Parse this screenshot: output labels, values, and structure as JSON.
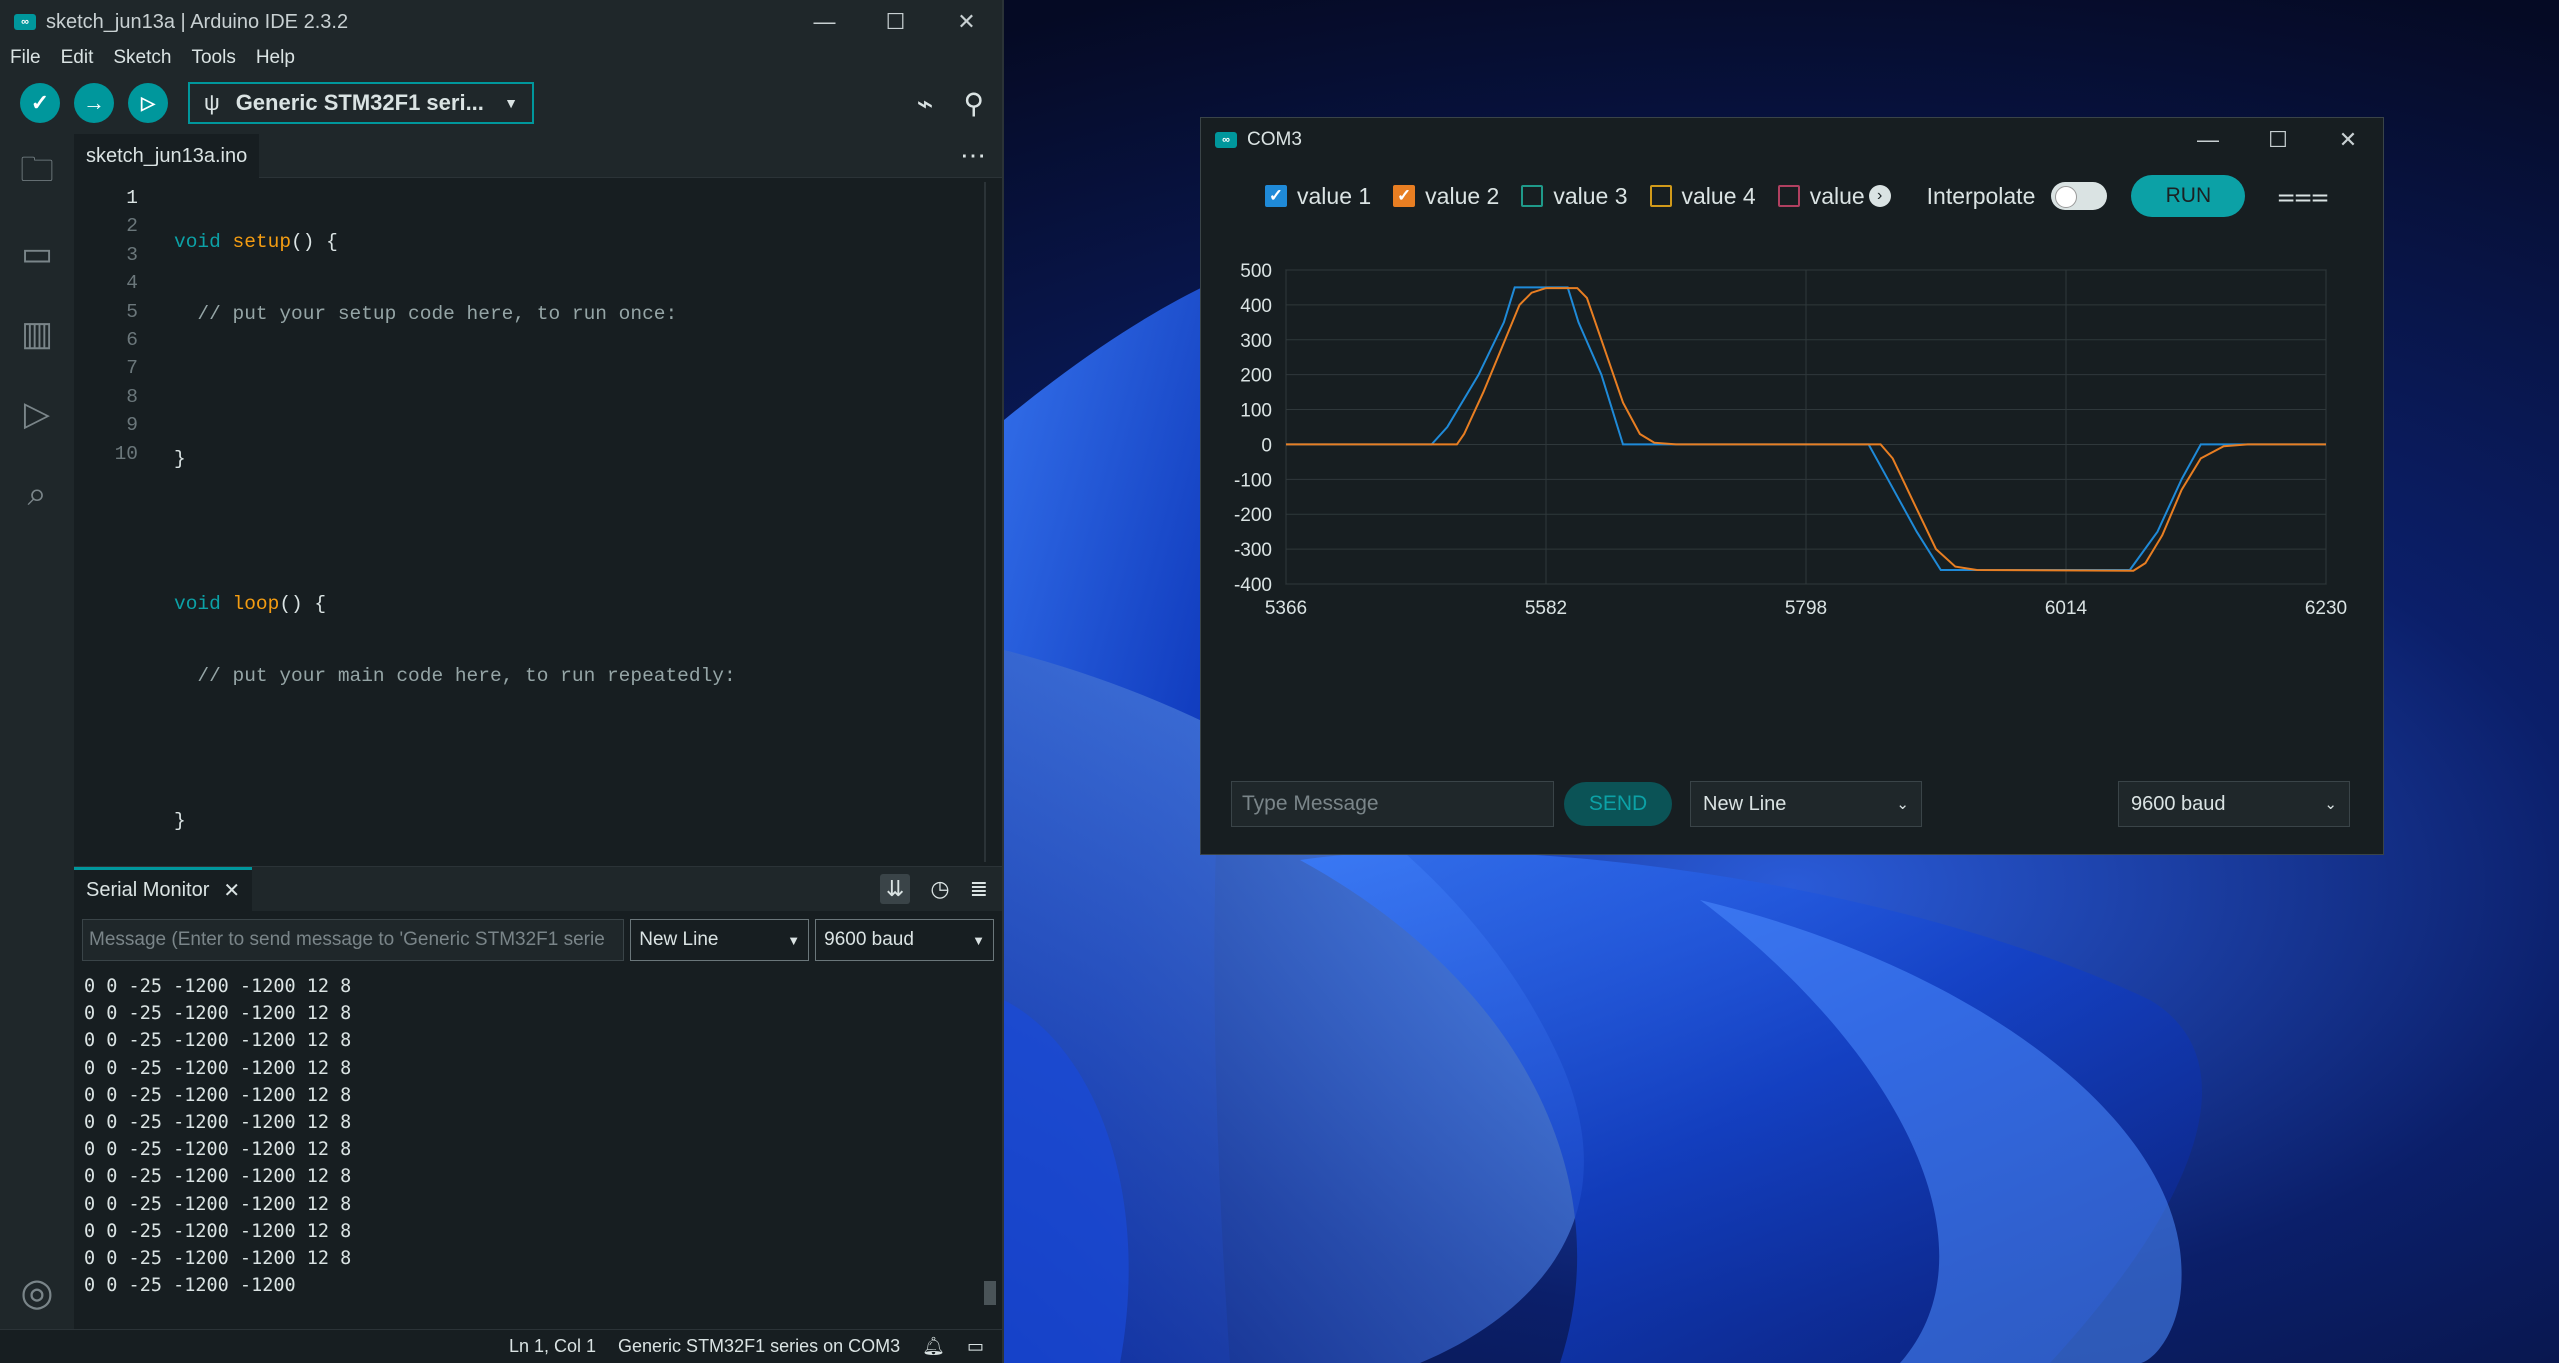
{
  "ide": {
    "title": "sketch_jun13a | Arduino IDE 2.3.2",
    "logo_text": "∞",
    "menu": [
      "File",
      "Edit",
      "Sketch",
      "Tools",
      "Help"
    ],
    "board": "Generic STM32F1 seri...",
    "tab": "sketch_jun13a.ino",
    "line_numbers": [
      "1",
      "2",
      "3",
      "4",
      "5",
      "6",
      "7",
      "8",
      "9",
      "10"
    ],
    "serial_monitor": {
      "title": "Serial Monitor",
      "message_placeholder": "Message (Enter to send message to 'Generic STM32F1 serie",
      "line_ending": "New Line",
      "baud": "9600 baud",
      "output": [
        "0 0 -25 -1200 -1200 12 8",
        "0 0 -25 -1200 -1200 12 8",
        "0 0 -25 -1200 -1200 12 8",
        "0 0 -25 -1200 -1200 12 8",
        "0 0 -25 -1200 -1200 12 8",
        "0 0 -25 -1200 -1200 12 8",
        "0 0 -25 -1200 -1200 12 8",
        "0 0 -25 -1200 -1200 12 8",
        "0 0 -25 -1200 -1200 12 8",
        "0 0 -25 -1200 -1200 12 8",
        "0 0 -25 -1200 -1200 12 8",
        "0 0 -25 -1200 -1200"
      ]
    },
    "status": {
      "position": "Ln 1, Col 1",
      "board_port": "Generic STM32F1 series on COM3"
    }
  },
  "plotter": {
    "title": "COM3",
    "series_labels": [
      "value 1",
      "value 2",
      "value 3",
      "value 4",
      "value"
    ],
    "series_checked": [
      true,
      true,
      false,
      false,
      false
    ],
    "series_colors": [
      "#1f8ad8",
      "#e87e22",
      "#1f9a8a",
      "#d19a1a",
      "#b04060"
    ],
    "interpolate_label": "Interpolate",
    "run_label": "RUN",
    "message_placeholder": "Type Message",
    "send_label": "SEND",
    "line_ending": "New Line",
    "baud": "9600 baud"
  },
  "chart_data": {
    "type": "line",
    "title": "",
    "xlabel": "",
    "ylabel": "",
    "xlim": [
      5366,
      6230
    ],
    "ylim": [
      -400,
      500
    ],
    "xticks": [
      5366,
      5582,
      5798,
      6014,
      6230
    ],
    "yticks": [
      500,
      400,
      300,
      200,
      100,
      0,
      -100,
      -200,
      -300,
      -400
    ],
    "grid": true,
    "series": [
      {
        "name": "value 1",
        "color": "#1f8ad8",
        "points": [
          [
            5366,
            0
          ],
          [
            5487,
            0
          ],
          [
            5500,
            50
          ],
          [
            5526,
            200
          ],
          [
            5547,
            350
          ],
          [
            5556,
            450
          ],
          [
            5600,
            450
          ],
          [
            5609,
            350
          ],
          [
            5628,
            200
          ],
          [
            5646,
            0
          ],
          [
            5850,
            0
          ],
          [
            5866,
            -100
          ],
          [
            5890,
            -250
          ],
          [
            5910,
            -360
          ],
          [
            6067,
            -360
          ],
          [
            6090,
            -250
          ],
          [
            6110,
            -100
          ],
          [
            6126,
            0
          ],
          [
            6230,
            0
          ]
        ]
      },
      {
        "name": "value 2",
        "color": "#e87e22",
        "points": [
          [
            5366,
            0
          ],
          [
            5508,
            0
          ],
          [
            5514,
            30
          ],
          [
            5530,
            150
          ],
          [
            5548,
            300
          ],
          [
            5560,
            400
          ],
          [
            5570,
            435
          ],
          [
            5582,
            448
          ],
          [
            5608,
            448
          ],
          [
            5616,
            420
          ],
          [
            5630,
            280
          ],
          [
            5646,
            120
          ],
          [
            5660,
            30
          ],
          [
            5672,
            5
          ],
          [
            5690,
            0
          ],
          [
            5860,
            0
          ],
          [
            5870,
            -40
          ],
          [
            5888,
            -170
          ],
          [
            5906,
            -300
          ],
          [
            5922,
            -350
          ],
          [
            5940,
            -360
          ],
          [
            6070,
            -362
          ],
          [
            6080,
            -340
          ],
          [
            6094,
            -260
          ],
          [
            6110,
            -130
          ],
          [
            6126,
            -40
          ],
          [
            6145,
            -5
          ],
          [
            6165,
            0
          ],
          [
            6230,
            0
          ]
        ]
      }
    ]
  }
}
